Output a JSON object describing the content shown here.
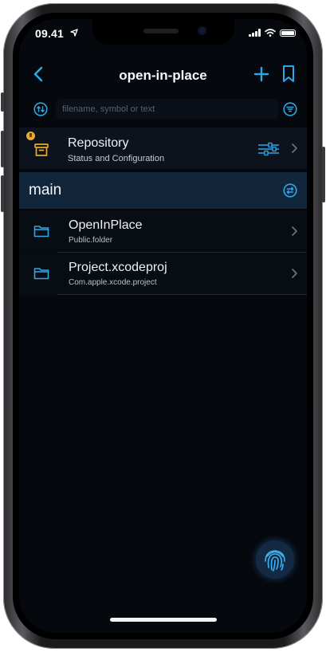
{
  "status_bar": {
    "time": "09.41"
  },
  "nav": {
    "title": "open-in-place"
  },
  "search": {
    "placeholder": "filename, symbol or text",
    "value": ""
  },
  "repository": {
    "title": "Repository",
    "subtitle": "Status and Configuration"
  },
  "branch": {
    "name": "main"
  },
  "files": [
    {
      "name": "OpenInPlace",
      "type": "Public.folder"
    },
    {
      "name": "Project.xcodeproj",
      "type": "Com.apple.xcode.project"
    }
  ],
  "colors": {
    "accent": "#2fa6e8",
    "background": "#05080d",
    "branch_bar": "#11263b",
    "badge": "#e7a92e"
  },
  "icons": [
    "back-chevron-icon",
    "plus-icon",
    "bookmark-icon",
    "sort-icon",
    "filter-icon",
    "archive-icon",
    "sliders-icon",
    "branch-switch-icon",
    "folder-icon",
    "fingerprint-icon"
  ]
}
